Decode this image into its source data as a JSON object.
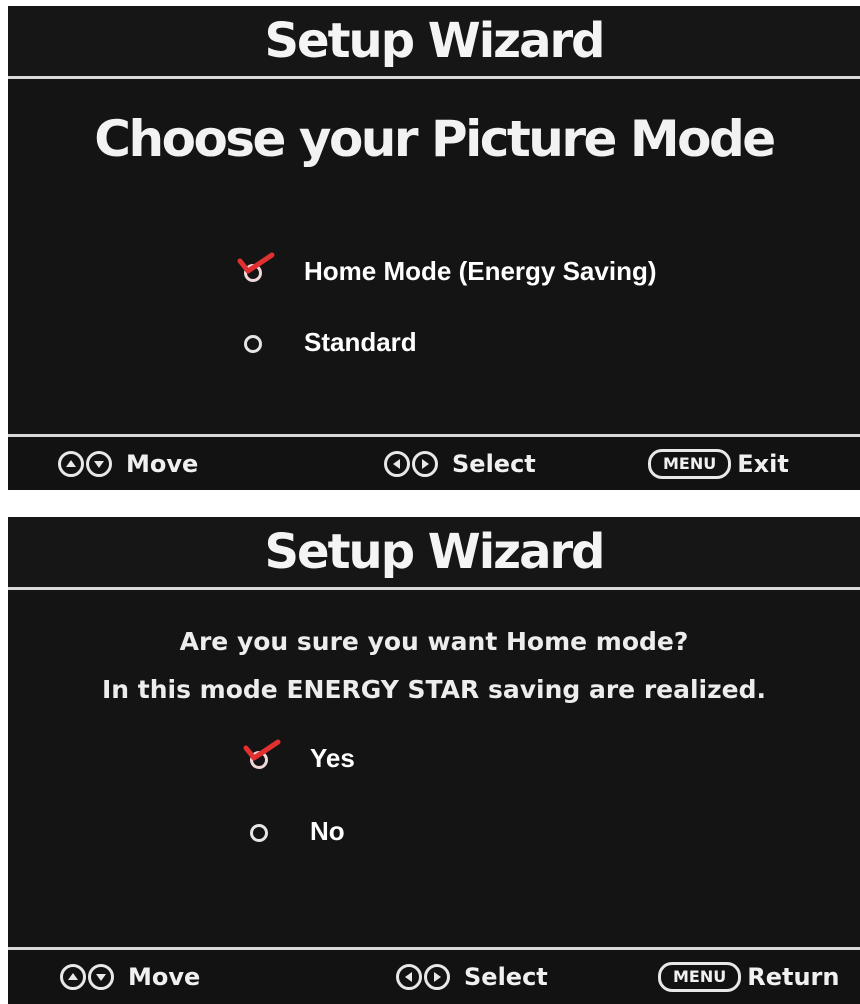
{
  "screen1": {
    "title": "Setup Wizard",
    "headline": "Choose your Picture Mode",
    "options": [
      {
        "label": "Home Mode (Energy Saving)",
        "selected": true
      },
      {
        "label": "Standard",
        "selected": false
      }
    ],
    "footer": {
      "move_label": "Move",
      "select_label": "Select",
      "menu_key": "MENU",
      "menu_action": "Exit"
    }
  },
  "screen2": {
    "title": "Setup Wizard",
    "question": "Are you sure you want Home mode?",
    "note": "In this mode ENERGY STAR saving are realized.",
    "options": [
      {
        "label": "Yes",
        "selected": true
      },
      {
        "label": "No",
        "selected": false
      }
    ],
    "footer": {
      "move_label": "Move",
      "select_label": "Select",
      "menu_key": "MENU",
      "menu_action": "Return"
    }
  },
  "colors": {
    "background": "#141414",
    "text": "#ffffff",
    "checkmark": "#e03030",
    "divider": "#d9d9d9"
  }
}
